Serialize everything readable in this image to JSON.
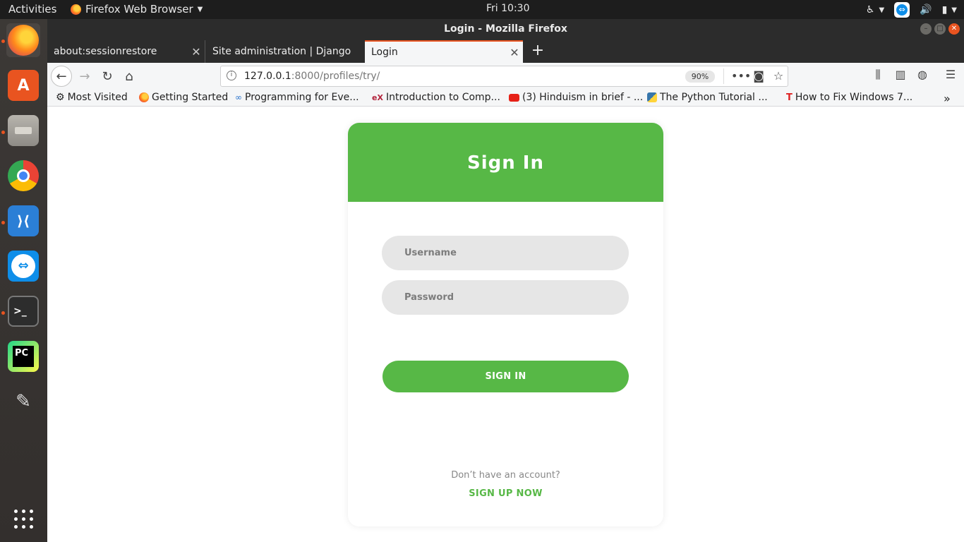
{
  "top_panel": {
    "activities": "Activities",
    "app_menu": "Firefox Web Browser",
    "clock": "Fri 10:30"
  },
  "dock": {
    "items": [
      {
        "name": "firefox",
        "color": "#ff7a1c"
      },
      {
        "name": "ubuntu-software",
        "color": "#e95420"
      },
      {
        "name": "files",
        "color": "#8a8a8a"
      },
      {
        "name": "chrome",
        "color": "#34a853"
      },
      {
        "name": "vscode",
        "color": "#2b7fd6"
      },
      {
        "name": "teamviewer",
        "color": "#0e8ee9"
      },
      {
        "name": "terminal",
        "color": "#2d2d2d"
      },
      {
        "name": "pycharm",
        "color": "#21d789"
      },
      {
        "name": "draw-app",
        "color": "#6a8fc9"
      }
    ]
  },
  "window": {
    "title": "Login - Mozilla Firefox"
  },
  "tabs": [
    {
      "label": "about:sessionrestore"
    },
    {
      "label": "Site administration | Django"
    },
    {
      "label": "Login"
    }
  ],
  "url": {
    "host": "127.0.0.1",
    "rest": ":8000/profiles/try/",
    "zoom": "90%"
  },
  "bookmarks": [
    {
      "label": "Most Visited",
      "icon": "gear-icon"
    },
    {
      "label": "Getting Started",
      "icon": "firefox-icon"
    },
    {
      "label": "Programming for Eve...",
      "icon": "coursera-icon"
    },
    {
      "label": "Introduction to Comp...",
      "icon": "edx-icon"
    },
    {
      "label": "(3) Hinduism in brief - ...",
      "icon": "youtube-icon"
    },
    {
      "label": "The Python Tutorial ...",
      "icon": "python-icon"
    },
    {
      "label": "How to Fix Windows 7...",
      "icon": "t-icon"
    }
  ],
  "login": {
    "title": "Sign In",
    "username_placeholder": "Username",
    "password_placeholder": "Password",
    "signin_label": "SIGN IN",
    "no_account_text": "Don’t have an account?",
    "signup_label": "SIGN UP NOW",
    "accent_color": "#57b846"
  }
}
